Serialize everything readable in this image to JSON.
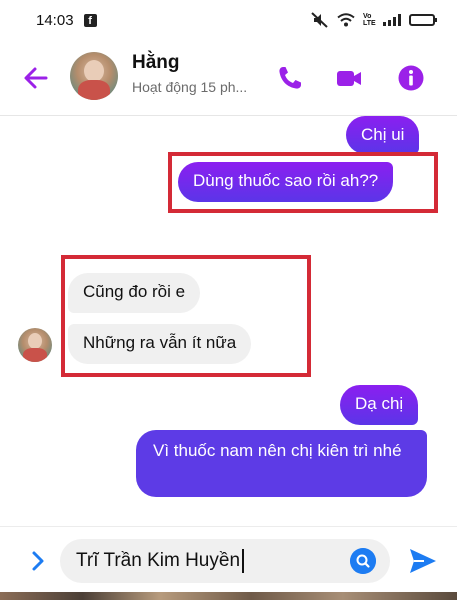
{
  "status_bar": {
    "time": "14:03",
    "fb_glyph": "f",
    "network_label": "Vo LTE",
    "battery_level": 0.8
  },
  "header": {
    "name": "Hằng",
    "status": "Hoạt động 15 ph...",
    "accent_color": "#9b21e8",
    "icons": [
      "back-arrow-icon",
      "phone-icon",
      "video-camera-icon",
      "info-icon"
    ]
  },
  "messages": [
    {
      "side": "out",
      "text": "Chị ui"
    },
    {
      "side": "out",
      "text": "Dùng thuốc sao rồi ah??"
    },
    {
      "side": "in",
      "text": "Cũng đo rồi e"
    },
    {
      "side": "in",
      "text": "Những ra vẫn ít nữa"
    },
    {
      "side": "out",
      "text": "Dạ chị"
    },
    {
      "side": "out",
      "text": "Vì thuốc nam nên chị kiên trì nhé"
    }
  ],
  "composer": {
    "value": "Trĩ Trần Kim Huyền",
    "icons": [
      "chevron-right-icon",
      "search-icon",
      "send-icon"
    ]
  },
  "colors": {
    "outgoing_bubble": "#7b24f2",
    "incoming_bubble": "#f0f0f0",
    "highlight": "#d42a36",
    "send": "#1d7cf2"
  }
}
